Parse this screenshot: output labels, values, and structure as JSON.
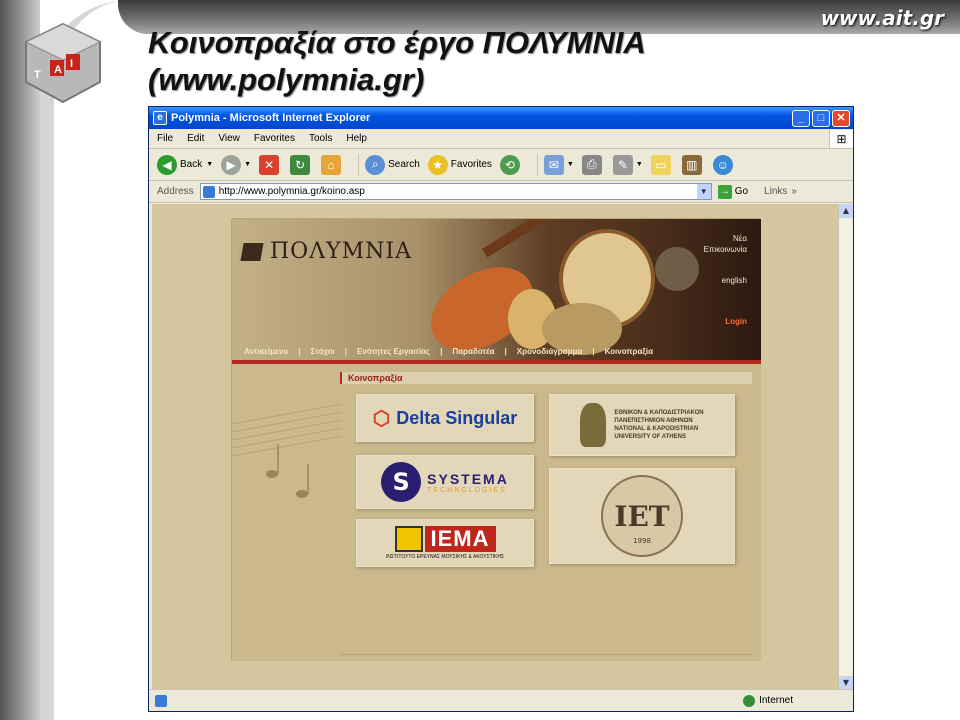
{
  "slide": {
    "site_url": "www.ait.gr",
    "title_line1": "Κοινοπραξία στο έργο ΠΟΛΥΜΝΙΑ",
    "title_line2": "(www.polymnia.gr)",
    "logo_letters": "A I T"
  },
  "window": {
    "title": "Polymnia - Microsoft Internet Explorer",
    "controls": {
      "minimize": "_",
      "maximize": "□",
      "close": "✕"
    }
  },
  "menu": [
    "File",
    "Edit",
    "View",
    "Favorites",
    "Tools",
    "Help"
  ],
  "toolbar": {
    "back": "Back",
    "search": "Search",
    "favorites": "Favorites"
  },
  "address": {
    "label": "Address",
    "url": "http://www.polymnia.gr/koino.asp",
    "go": "Go",
    "links": "Links",
    "more": "»"
  },
  "status": {
    "zone": "Internet"
  },
  "site": {
    "logo_text": "ΠΟΛΥΜΝΙΑ",
    "header_links": {
      "news": "Νέα",
      "contact": "Επικοινωνία",
      "english": "english",
      "login": "Login"
    },
    "nav": [
      "Αντικείμενο",
      "Στόχοι",
      "Ενότητες Εργασίας",
      "Παραδοτέα",
      "Χρονοδιάγραμμα",
      "Κοινοπραξία"
    ],
    "section_title": "Κοινοπραξία",
    "partners": {
      "delta": {
        "name": "Delta Singular"
      },
      "systema": {
        "name": "SYSTEMA",
        "sub": "TECHNOLOGIES"
      },
      "iema": {
        "name": "IEMA",
        "sub": "ΙΝΣΤΙΤΟΥΤΟ ΕΡΕΥΝΑΣ ΜΟΥΣΙΚΗΣ & ΑΚΟΥΣΤΙΚΗΣ"
      },
      "uoa": {
        "line1": "ΕΘΝΙΚΟΝ & ΚΑΠΟΔΙΣΤΡΙΑΚΟΝ",
        "line2": "ΠΑΝΕΠΙΣΤΗΜΙΟΝ ΑΘΗΝΩΝ",
        "line3": "NATIONAL & KAPODISTRIAN",
        "line4": "UNIVERSITY OF ATHENS"
      },
      "ilsp": {
        "year": "1998"
      }
    }
  }
}
